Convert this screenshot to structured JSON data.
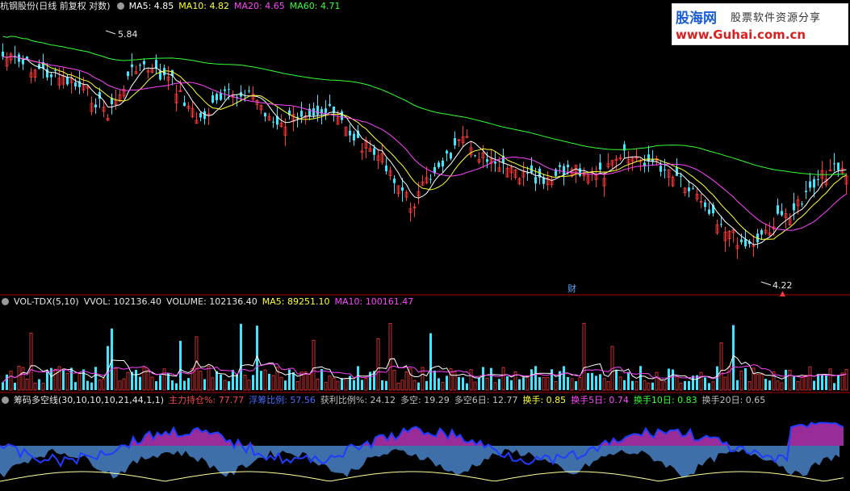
{
  "main_panel": {
    "title": "杭钢股份(日线 前复权 对数)",
    "indicators": [
      {
        "label": "MA5: 4.85",
        "color": "#ffffff"
      },
      {
        "label": "MA10: 4.82",
        "color": "#ffff33"
      },
      {
        "label": "MA20: 4.65",
        "color": "#ff44ff"
      },
      {
        "label": "MA60: 4.71",
        "color": "#33ff33"
      }
    ],
    "high_label": "5.84",
    "low_label": "4.22",
    "event_marker": "财",
    "red_marker": "▲"
  },
  "volume_panel": {
    "title": "VOL-TDX(5,10)",
    "indicators": [
      {
        "label": "VVOL: 102136.40",
        "color": "#e8e8e8"
      },
      {
        "label": "VOLUME: 102136.40",
        "color": "#e8e8e8"
      },
      {
        "label": "MA5: 89251.10",
        "color": "#ffff33"
      },
      {
        "label": "MA10: 100161.47",
        "color": "#ff44ff"
      }
    ]
  },
  "chip_panel": {
    "title": "筹码多空线(30,10,10,10,21,44,1,1)",
    "indicators": [
      {
        "label": "主力持仓%: 77.77",
        "color": "#ff4a4a"
      },
      {
        "label": "浮筹比例: 57.56",
        "color": "#4a6bff"
      },
      {
        "label": "获利比例%: 24.12",
        "color": "#c0c0c0"
      },
      {
        "label": "多空: 19.29",
        "color": "#c0c0c0"
      },
      {
        "label": "多空6日: 12.77",
        "color": "#c0c0c0"
      },
      {
        "label": "换手: 0.85",
        "color": "#ffff33"
      },
      {
        "label": "换手5日: 0.74",
        "color": "#ff44ff"
      },
      {
        "label": "换手10日: 0.83",
        "color": "#33ff33"
      },
      {
        "label": "换手20日: 0.65",
        "color": "#c0c0c0"
      }
    ]
  },
  "watermark": {
    "brand": "股海网",
    "slogan": "股票软件资源分享",
    "url": "www.Guhai.com.cn"
  },
  "colors": {
    "up": "#ff3a3a",
    "down": "#40e6ff",
    "ma5": "#ffffff",
    "ma10": "#ffff33",
    "ma20": "#ff44ff",
    "ma60": "#33ff33",
    "divider": "#b00000",
    "chip_blue": "#3e6fa8",
    "chip_purple": "#9a2c9a",
    "chip_line": "#1f3cff"
  }
}
